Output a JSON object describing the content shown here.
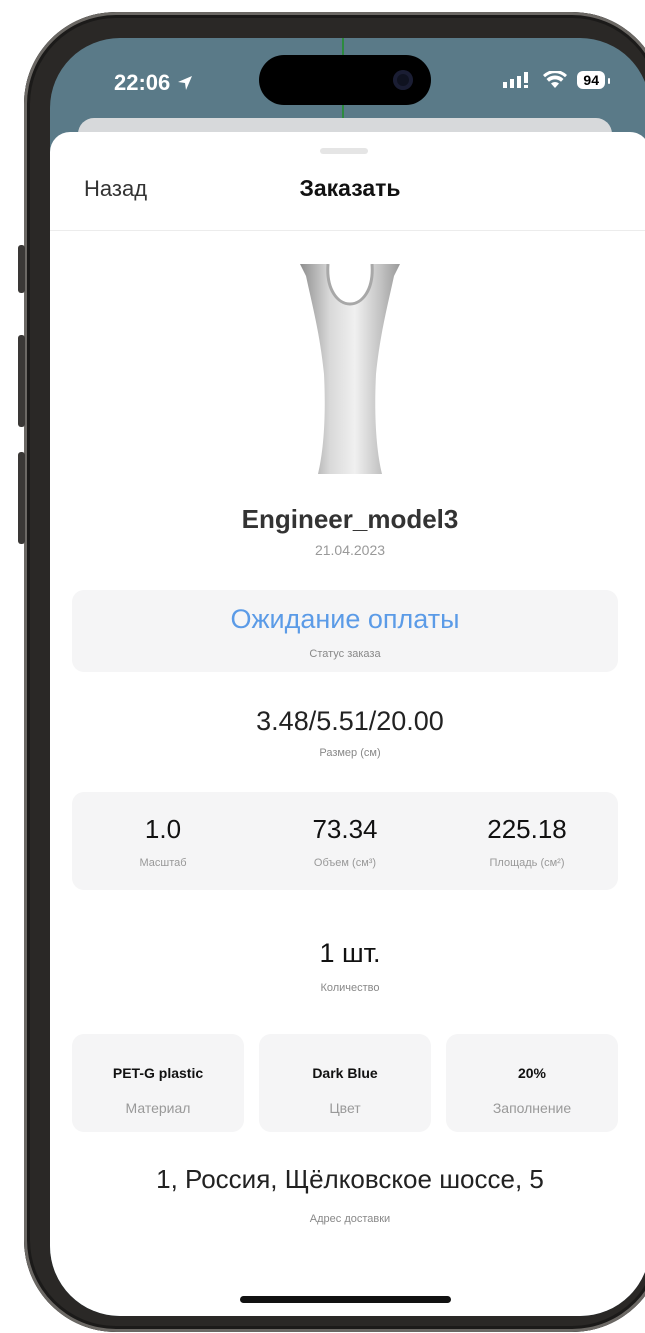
{
  "status_bar": {
    "time": "22:06",
    "battery": "94"
  },
  "nav": {
    "back_label": "Назад",
    "title": "Заказать"
  },
  "model": {
    "name": "Engineer_model3",
    "date": "21.04.2023"
  },
  "order_status": {
    "value": "Ожидание оплаты",
    "label": "Статус заказа",
    "color": "#5b9be7"
  },
  "size": {
    "value": "3.48/5.51/20.00",
    "label": "Размер (см)"
  },
  "stats": [
    {
      "value": "1.0",
      "label": "Масштаб"
    },
    {
      "value": "73.34",
      "label": "Объем (см³)"
    },
    {
      "value": "225.18",
      "label": "Площадь (см²)"
    }
  ],
  "quantity": {
    "value": "1 шт.",
    "label": "Количество"
  },
  "specs": [
    {
      "value": "PET-G plastic",
      "label": "Материал"
    },
    {
      "value": "Dark Blue",
      "label": "Цвет"
    },
    {
      "value": "20%",
      "label": "Заполнение"
    }
  ],
  "address": {
    "value": "1, Россия, Щёлковское шоссе, 5",
    "label": "Адрес доставки"
  }
}
